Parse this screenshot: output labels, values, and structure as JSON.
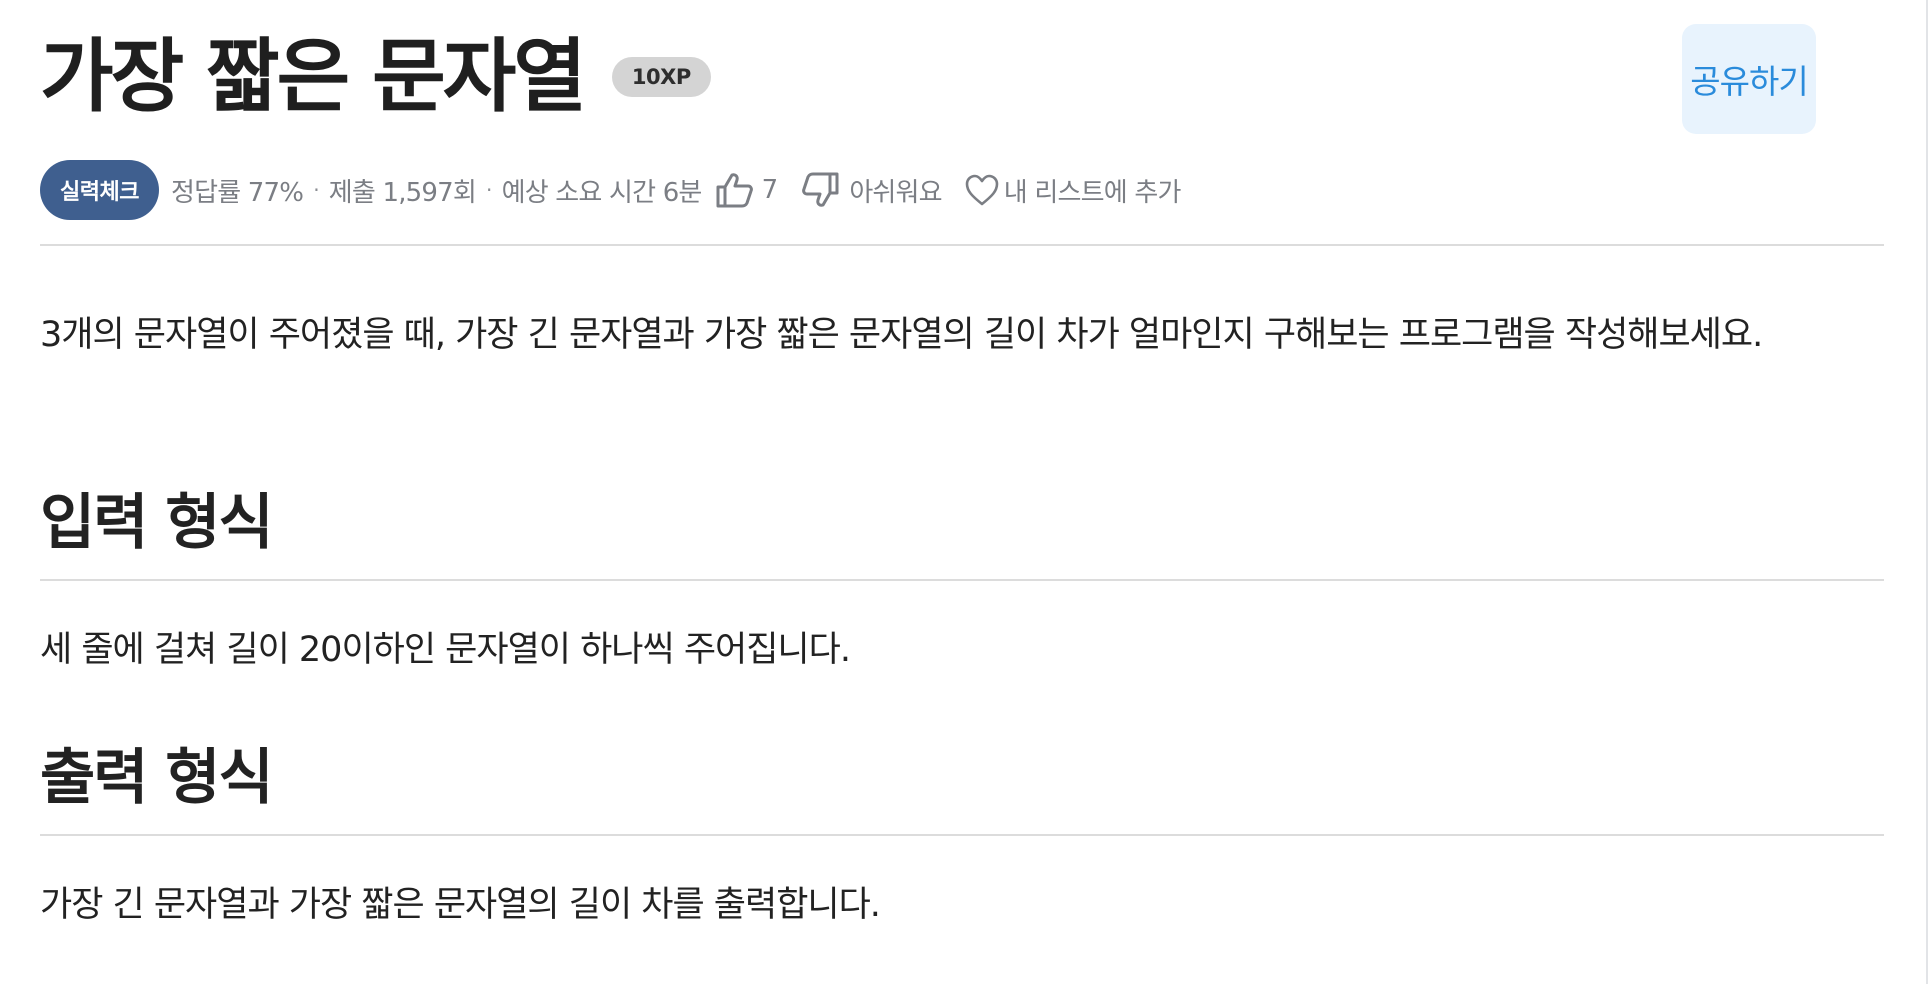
{
  "problem": {
    "title": "가장 짧은 문자열",
    "xp_badge": "10XP",
    "share_label": "공유하기"
  },
  "meta": {
    "level_badge": "실력체크",
    "accuracy": "정답률 77%",
    "submissions": "제출 1,597회",
    "estimated_time": "예상 소요 시간 6분",
    "like_count": "7",
    "dislike_label": "아쉬워요",
    "add_to_list_label": "내 리스트에 추가",
    "separator": "·"
  },
  "content": {
    "description": "3개의 문자열이 주어졌을 때, 가장 긴 문자열과 가장 짧은 문자열의 길이 차가 얼마인지 구해보는 프로그램을 작성해보세요.",
    "input_heading": "입력 형식",
    "input_text": "세 줄에 걸쳐 길이 20이하인 문자열이 하나씩 주어집니다.",
    "output_heading": "출력 형식",
    "output_text": "가장 긴 문자열과 가장 짧은 문자열의 길이 차를 출력합니다."
  },
  "icons": {
    "like": "thumbs-up-icon",
    "dislike": "thumbs-down-icon",
    "add_to_list": "heart-icon"
  },
  "colors": {
    "level_badge_bg": "#3f5f8f",
    "share_button_bg": "#e8f3fd",
    "share_button_text": "#2a8bdb",
    "xp_badge_bg": "#d4d4d4",
    "meta_text": "#7b7e84",
    "divider": "#dcdcdc"
  }
}
